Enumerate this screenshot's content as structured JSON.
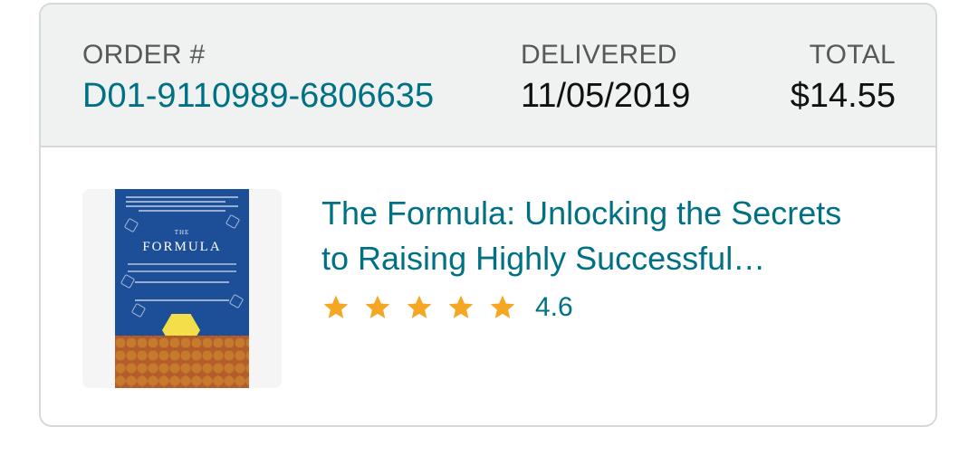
{
  "order": {
    "order_label": "ORDER #",
    "order_number": "D01-9110989-6806635",
    "delivered_label": "DELIVERED",
    "delivered_date": "11/05/2019",
    "total_label": "TOTAL",
    "total_value": "$14.55"
  },
  "item": {
    "title_line1": "The Formula: Unlocking the Secrets",
    "title_line2": "to Raising Highly Successful…",
    "cover_small_title": "THE",
    "cover_big_title": "FORMULA",
    "rating_value": "4.6",
    "rating": 4.6,
    "rating_max": 5,
    "star_icon": "star-icon",
    "star_color": "#f5a623"
  },
  "colors": {
    "link": "#007185",
    "header_bg": "#f0f2f2",
    "border": "#d5d9d9",
    "cover_bg": "#1d4f99"
  }
}
